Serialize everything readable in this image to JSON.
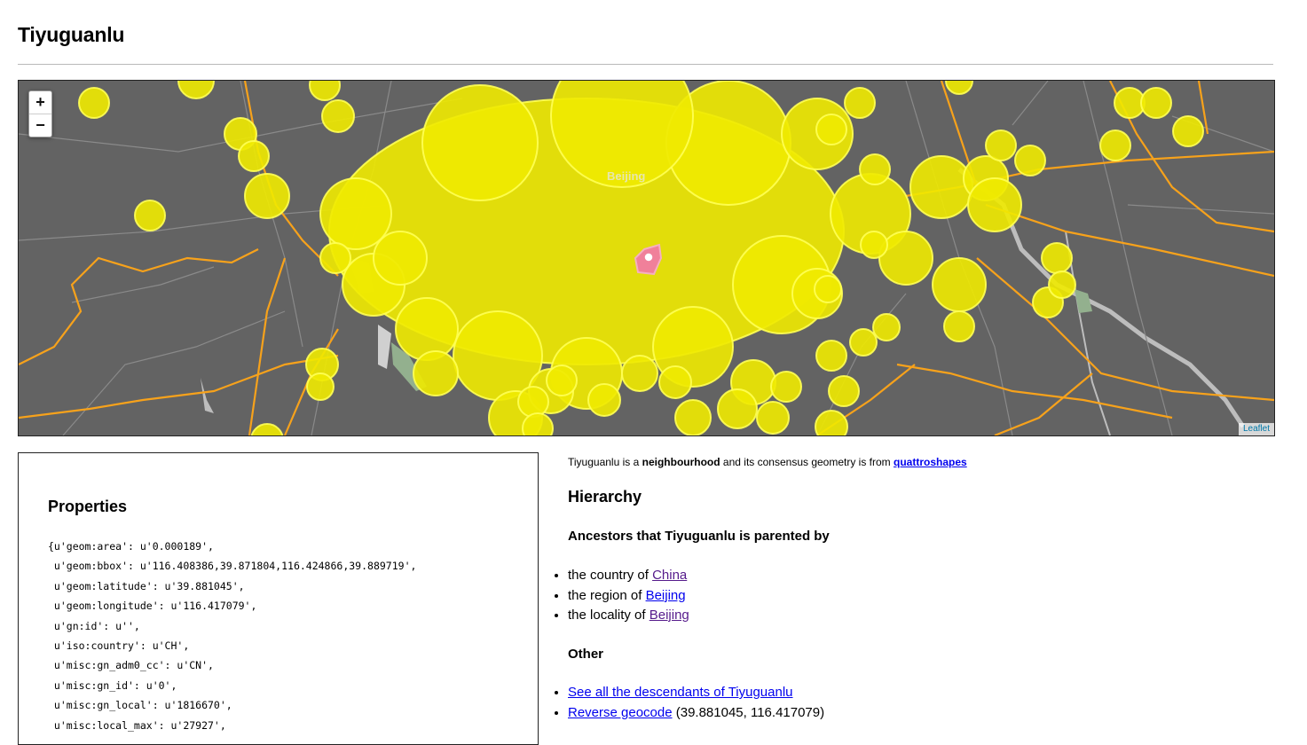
{
  "page": {
    "title": "Tiyuguanlu"
  },
  "map": {
    "zoom_in": "+",
    "zoom_out": "−",
    "label_city": "Beijing",
    "attribution": "Leaflet",
    "colors": {
      "land": "#636363",
      "coverage": "#f0ea00",
      "selected": "#f0809a",
      "major_road": "#f7a21b",
      "minor_road": "#8a8a8a",
      "park": "#93b08e",
      "water": "#bdbdbd"
    }
  },
  "properties": {
    "heading": "Properties",
    "lines": [
      "{u'geom:area': u'0.000189',",
      " u'geom:bbox': u'116.408386,39.871804,116.424866,39.889719',",
      " u'geom:latitude': u'39.881045',",
      " u'geom:longitude': u'116.417079',",
      " u'gn:id': u'',",
      " u'iso:country': u'CH',",
      " u'misc:gn_adm0_cc': u'CN',",
      " u'misc:gn_id': u'0',",
      " u'misc:gn_local': u'1816670',",
      " u'misc:local_max': u'27927',"
    ]
  },
  "summary": {
    "name": "Tiyuguanlu",
    "text_1": " is a ",
    "placetype": "neighbourhood",
    "text_2": " and its consensus geometry is from ",
    "source": "quattroshapes"
  },
  "hierarchy": {
    "heading": "Hierarchy",
    "ancestors_heading": "Ancestors that Tiyuguanlu is parented by",
    "ancestors": [
      {
        "prefix": "the country of ",
        "link": "China"
      },
      {
        "prefix": "the region of ",
        "link": "Beijing"
      },
      {
        "prefix": "the locality of ",
        "link": "Beijing"
      }
    ],
    "other_heading": "Other",
    "other": [
      {
        "link": "See all the descendants of Tiyuguanlu",
        "suffix": ""
      },
      {
        "link": "Reverse geocode",
        "suffix": " (39.881045, 116.417079)"
      }
    ]
  }
}
